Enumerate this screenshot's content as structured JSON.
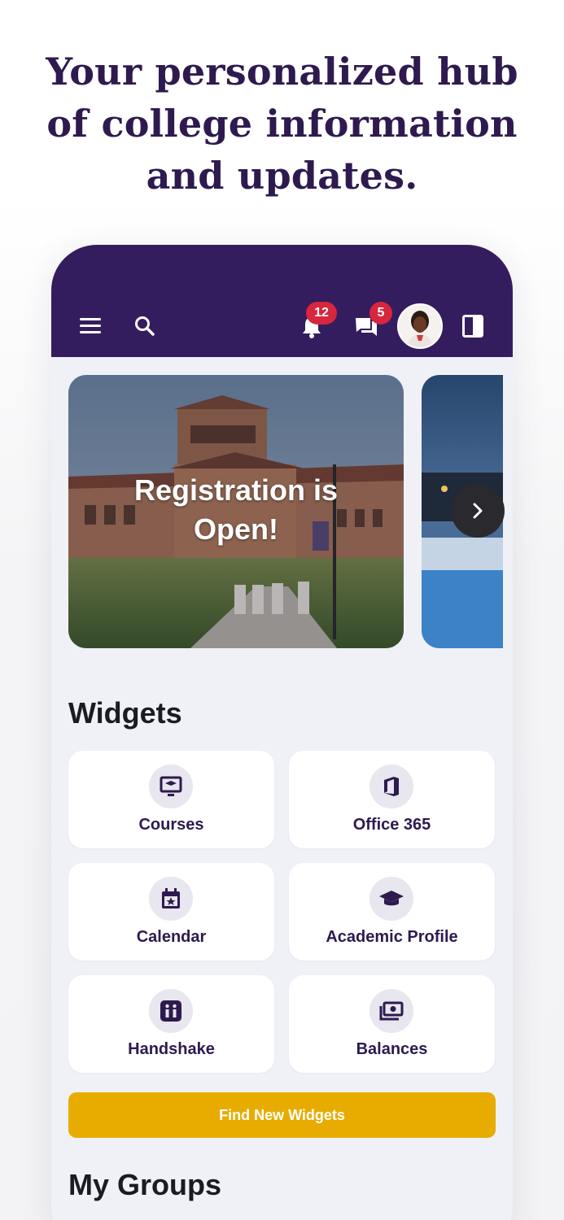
{
  "headline": {
    "line1": "Your personalized hub",
    "line2": "of college information",
    "line3": "and updates."
  },
  "appbar": {
    "notifications_count": "12",
    "messages_count": "5",
    "icons": [
      "menu-icon",
      "search-icon",
      "bell-icon",
      "chat-icon",
      "avatar",
      "panel-icon"
    ],
    "color": "#341d5e"
  },
  "carousel": {
    "slides": [
      {
        "title": "Registration is Open!"
      },
      {
        "title": ""
      }
    ]
  },
  "widgets": {
    "title": "Widgets",
    "items": [
      {
        "label": "Courses",
        "icon": "presentation-icon"
      },
      {
        "label": "Office 365",
        "icon": "office-icon"
      },
      {
        "label": "Calendar",
        "icon": "calendar-icon"
      },
      {
        "label": "Academic Profile",
        "icon": "graduation-cap-icon"
      },
      {
        "label": "Handshake",
        "icon": "handshake-icon"
      },
      {
        "label": "Balances",
        "icon": "money-icon"
      }
    ],
    "find_label": "Find New Widgets"
  },
  "groups": {
    "title": "My Groups"
  },
  "colors": {
    "accent": "#e8ac00",
    "brand": "#341d5e",
    "badge": "#d7263d"
  }
}
